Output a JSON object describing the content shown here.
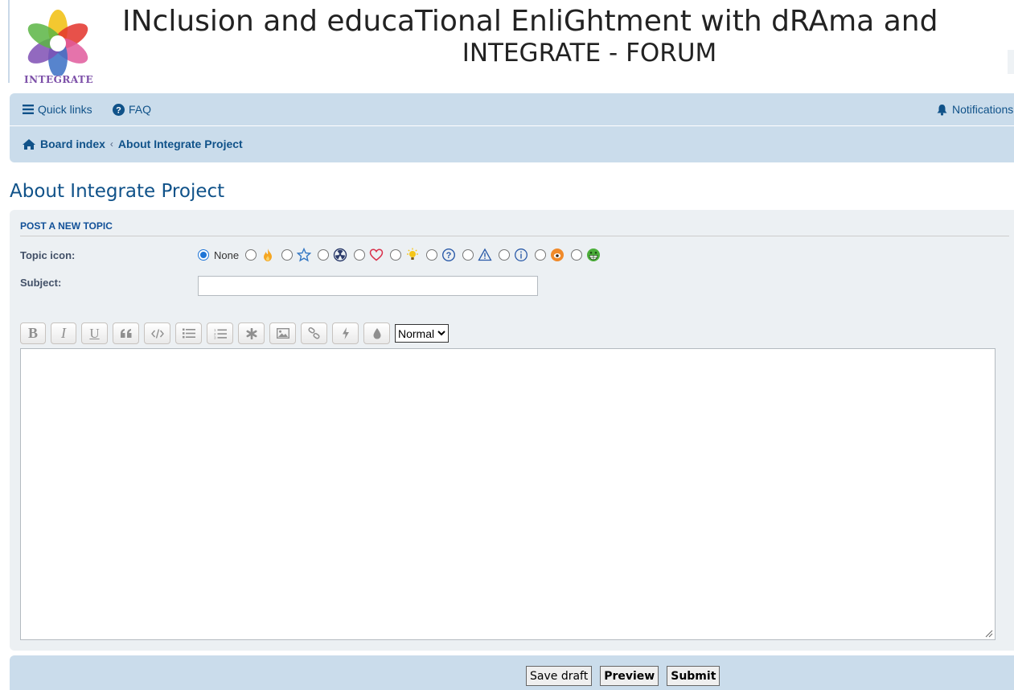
{
  "header": {
    "logo_text": "INTEGRATE",
    "title": "INclusion and educaTional EnliGhtment with dRAma and",
    "subtitle": "INTEGRATE - FORUM"
  },
  "nav": {
    "quick_links": "Quick links",
    "faq": "FAQ",
    "notifications": "Notifications",
    "breadcrumb": [
      "Board index",
      "About Integrate Project"
    ],
    "breadcrumb_separator": "‹"
  },
  "page": {
    "forum_title": "About Integrate Project"
  },
  "post_form": {
    "section_title": "POST A NEW TOPIC",
    "topic_icon_label": "Topic icon:",
    "topic_icon_none": "None",
    "topic_icons": [
      "fire",
      "star",
      "radioactive",
      "heart",
      "idea",
      "question",
      "warning",
      "info",
      "mad",
      "grin"
    ],
    "subject_label": "Subject:",
    "subject_value": "",
    "toolbar": {
      "buttons": [
        "bold",
        "italic",
        "underline",
        "quote",
        "code",
        "list",
        "ordered-list",
        "list-item",
        "image",
        "link",
        "flash",
        "color"
      ],
      "font_size": "Normal"
    },
    "message_value": ""
  },
  "actions": {
    "save_draft": "Save draft",
    "preview": "Preview",
    "submit": "Submit"
  },
  "colors": {
    "link": "#105289",
    "nav_bg": "#cadceb",
    "panel_bg": "#ecf0f3",
    "radio_checked": "#1e74d6"
  }
}
